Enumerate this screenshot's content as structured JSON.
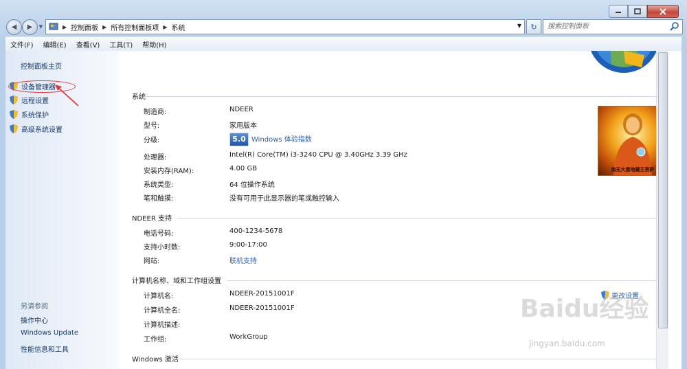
{
  "window": {
    "controls": [
      "minimize",
      "maximize",
      "close"
    ]
  },
  "breadcrumb": [
    "控制面板",
    "所有控制面板项",
    "系统"
  ],
  "search": {
    "placeholder": "搜索控制面板"
  },
  "menu": [
    "文件(F)",
    "编辑(E)",
    "查看(V)",
    "工具(T)",
    "帮助(H)"
  ],
  "sidebar": {
    "home": "控制面板主页",
    "tasks": [
      "设备管理器",
      "远程设置",
      "系统保护",
      "高级系统设置"
    ],
    "see_also_title": "另请参阅",
    "see_also": [
      "操作中心",
      "Windows Update",
      "性能信息和工具"
    ]
  },
  "system": {
    "title": "系统",
    "rows": [
      {
        "label": "制造商:",
        "value": "NDEER"
      },
      {
        "label": "型号:",
        "value": "家用版本"
      },
      {
        "label": "分级:",
        "score": "5.0",
        "value": "Windows 体验指数"
      },
      {
        "label": "处理器:",
        "value": "Intel(R) Core(TM) i3-3240 CPU @ 3.40GHz   3.39 GHz"
      },
      {
        "label": "安装内存(RAM):",
        "value": "4.00 GB"
      },
      {
        "label": "系统类型:",
        "value": "64 位操作系统"
      },
      {
        "label": "笔和触摸:",
        "value": "没有可用于此显示器的笔或触控输入"
      }
    ],
    "oem_caption": "南无大愿地藏王菩萨"
  },
  "support": {
    "title": "NDEER 支持",
    "rows": [
      {
        "label": "电话号码:",
        "value": "400-1234-5678"
      },
      {
        "label": "支持小时数:",
        "value": "9:00-17:00"
      },
      {
        "label": "网站:",
        "value": "联机支持"
      }
    ]
  },
  "computer": {
    "title": "计算机名称、域和工作组设置",
    "change": "更改设置",
    "rows": [
      {
        "label": "计算机名:",
        "value": "NDEER-20151001F"
      },
      {
        "label": "计算机全名:",
        "value": "NDEER-20151001F"
      },
      {
        "label": "计算机描述:",
        "value": ""
      },
      {
        "label": "工作组:",
        "value": "WorkGroup"
      }
    ]
  },
  "activation": {
    "title": "Windows 激活"
  },
  "watermark": {
    "text": "Baidu经验",
    "sub": "jingyan.baidu.com"
  },
  "colors": {
    "link": "#2a5fb0",
    "annotation": "#e23a3a",
    "titlebar": "#b7cfe8"
  }
}
